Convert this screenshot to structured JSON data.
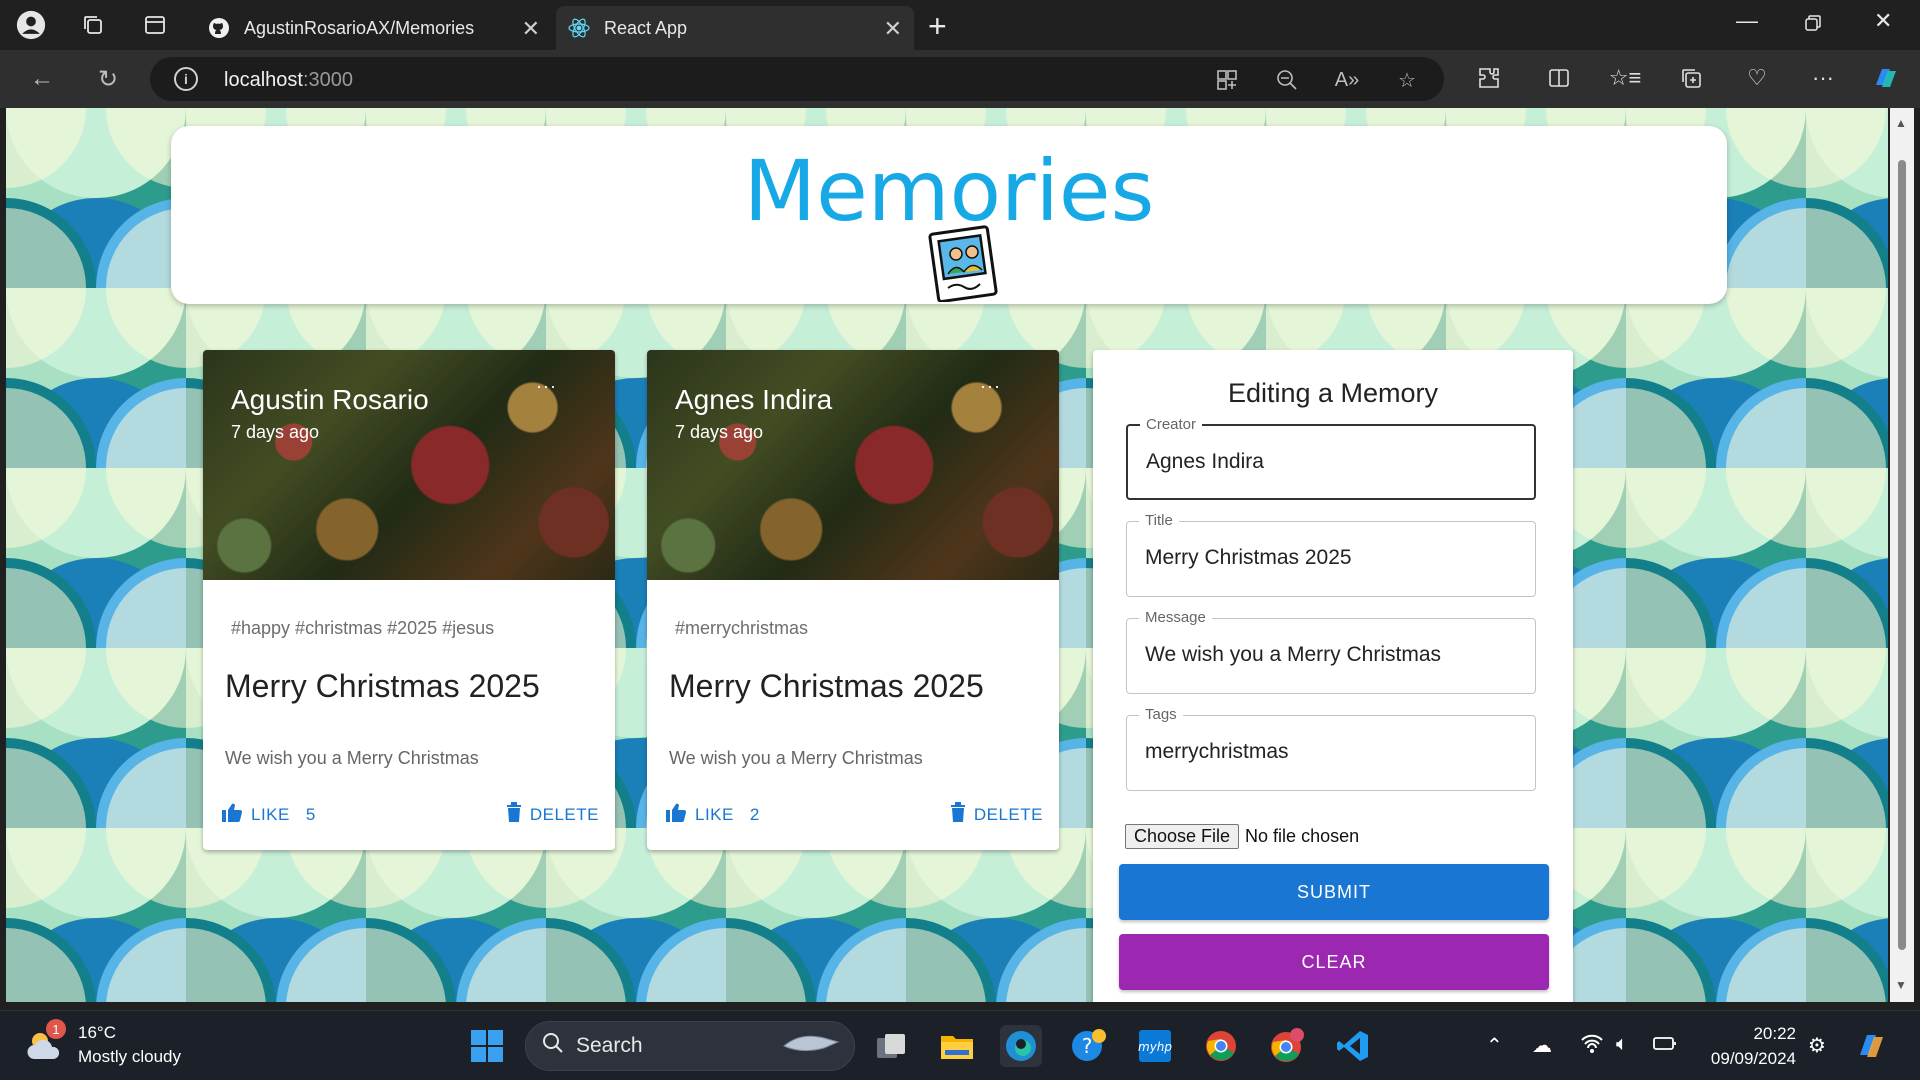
{
  "browser": {
    "tabs": [
      {
        "label": "AgustinRosarioAX/Memories",
        "icon": "github-icon"
      },
      {
        "label": "React App",
        "icon": "react-icon"
      }
    ],
    "url_host": "localhost",
    "url_port": ":3000"
  },
  "app": {
    "title": "Memories"
  },
  "posts": [
    {
      "creator": "Agustin Rosario",
      "time_ago": "7 days ago",
      "more": "···",
      "tags": "#happy #christmas #2025 #jesus",
      "title": "Merry Christmas 2025",
      "message": "We wish you a Merry Christmas",
      "like_label": "LIKE",
      "like_count": "5",
      "delete_label": "DELETE"
    },
    {
      "creator": "Agnes Indira",
      "time_ago": "7 days ago",
      "more": "···",
      "tags": "#merrychristmas",
      "title": "Merry Christmas 2025",
      "message": "We wish you a Merry Christmas",
      "like_label": "LIKE",
      "like_count": "2",
      "delete_label": "DELETE"
    }
  ],
  "form": {
    "heading": "Editing a Memory",
    "creator_label": "Creator",
    "creator_value": "Agnes Indira",
    "title_label": "Title",
    "title_value": "Merry Christmas 2025",
    "message_label": "Message",
    "message_value": "We wish you a Merry Christmas",
    "tags_label": "Tags",
    "tags_value": "merrychristmas",
    "file_button": "Choose File",
    "file_status": "No file chosen",
    "submit_label": "SUBMIT",
    "clear_label": "CLEAR"
  },
  "taskbar": {
    "temperature": "16°C",
    "weather": "Mostly cloudy",
    "weather_badge": "1",
    "search_label": "Search",
    "time": "20:22",
    "date": "09/09/2024"
  },
  "colors": {
    "accent_blue": "#1976d2",
    "accent_purple": "#9c27b0",
    "title_blue": "#17a8e6"
  }
}
